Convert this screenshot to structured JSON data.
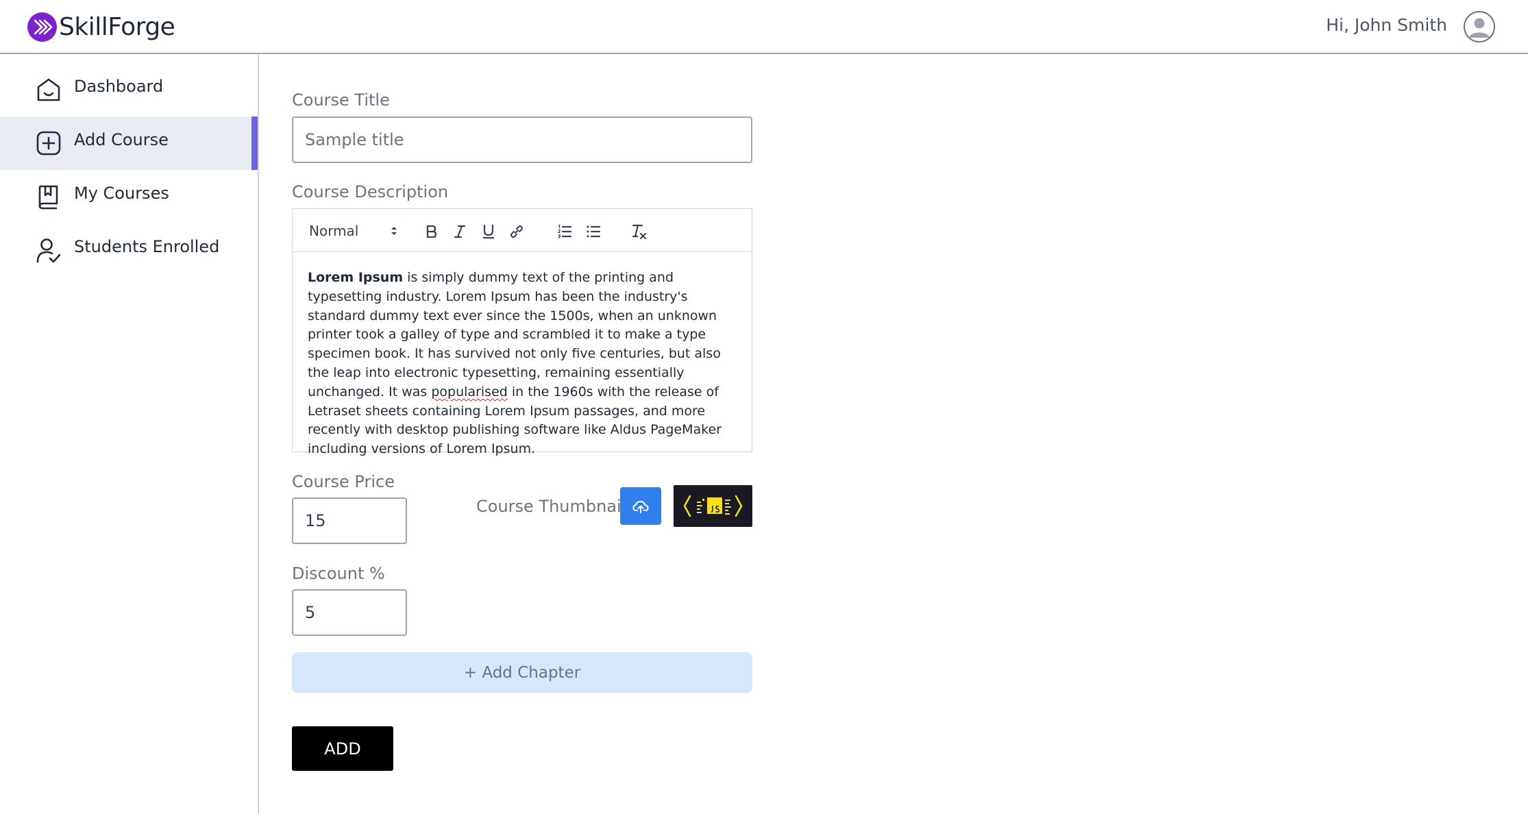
{
  "header": {
    "brand": "SkillForge",
    "greeting": "Hi, John Smith"
  },
  "sidebar": {
    "items": [
      {
        "label": "Dashboard",
        "icon": "home-icon",
        "active": false
      },
      {
        "label": "Add Course",
        "icon": "add-square-icon",
        "active": true
      },
      {
        "label": "My Courses",
        "icon": "book-icon",
        "active": false
      },
      {
        "label": "Students Enrolled",
        "icon": "user-check-icon",
        "active": false
      }
    ]
  },
  "form": {
    "title_label": "Course Title",
    "title_placeholder": "Sample title",
    "title_value": "",
    "description_label": "Course Description",
    "editor_format": "Normal",
    "description": {
      "bold_lead": "Lorem Ipsum",
      "text_before_squiggle": " is simply dummy text of the printing and typesetting industry. Lorem Ipsum has been the industry's standard dummy text ever since the 1500s, when an unknown printer took a galley of type and scrambled it to make a type specimen book. It has survived not only five centuries, but also the leap into electronic typesetting, remaining essentially unchanged. It was ",
      "squiggle_word": "popularised",
      "text_after_squiggle": " in the 1960s with the release of Letraset sheets containing Lorem Ipsum passages, and more recently with desktop publishing software like Aldus PageMaker including versions of Lorem Ipsum."
    },
    "price_label": "Course Price",
    "price_value": "15",
    "thumbnail_label": "Course Thumbnail",
    "discount_label": "Discount %",
    "discount_value": "5",
    "add_chapter_label": "+ Add Chapter",
    "submit_label": "ADD"
  },
  "colors": {
    "brand_purple": "#7e22ce",
    "active_accent": "#6c63e6",
    "active_bg": "#e8ebf4",
    "upload_blue": "#2f80ed",
    "add_chapter_bg": "#d8e6fb",
    "submit_bg": "#000000"
  }
}
